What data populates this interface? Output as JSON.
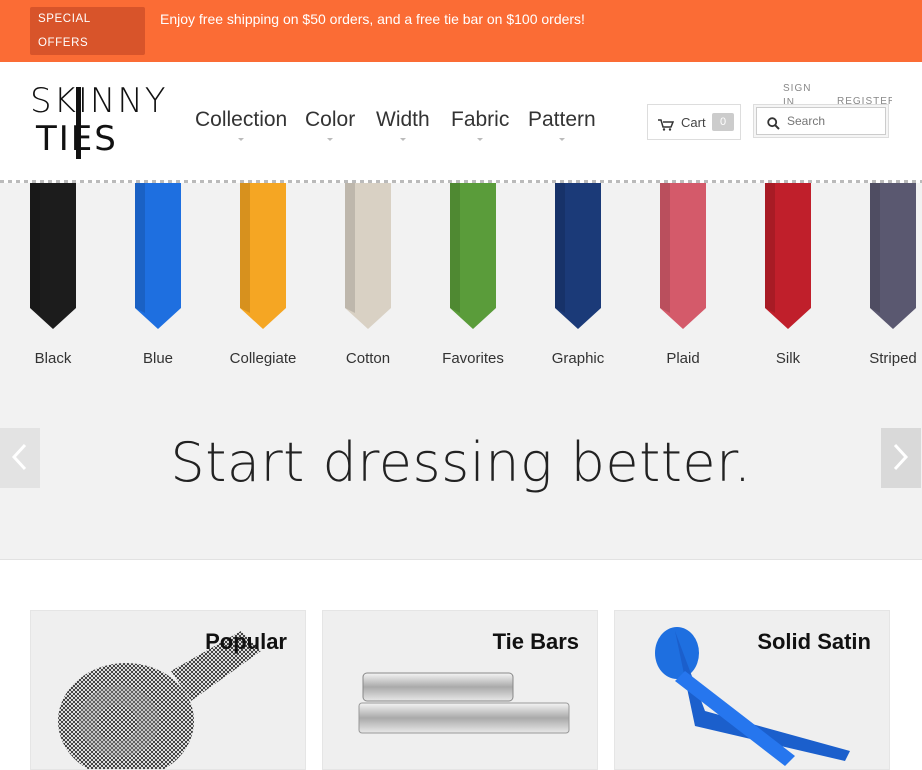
{
  "promo": {
    "badge_line1": "SPECIAL",
    "badge_line2": "OFFERS",
    "message": "Enjoy free shipping on $50 orders, and a free tie bar on $100 orders!",
    "background": "#fb6c35"
  },
  "logo": {
    "line1": "SKINNY",
    "line2": "TIES"
  },
  "nav": [
    "Collection",
    "Color",
    "Width",
    "Fabric",
    "Pattern"
  ],
  "cart": {
    "label": "Cart",
    "count": "0"
  },
  "account": {
    "sign_in": "SIGN IN",
    "register": "REGISTER"
  },
  "search": {
    "placeholder": "Search"
  },
  "ties": [
    {
      "label": "Black",
      "color": "#1c1c1c"
    },
    {
      "label": "Blue",
      "color": "#1e6fe0"
    },
    {
      "label": "Collegiate",
      "color": "#f5a623"
    },
    {
      "label": "Cotton",
      "color": "#d9d1c4"
    },
    {
      "label": "Favorites",
      "color": "#5a9c3a"
    },
    {
      "label": "Graphic",
      "color": "#1b3a78"
    },
    {
      "label": "Plaid",
      "color": "#d45a6a"
    },
    {
      "label": "Silk",
      "color": "#c01f2b"
    },
    {
      "label": "Striped",
      "color": "#5a5870"
    }
  ],
  "hero": {
    "headline": "Start dressing better."
  },
  "cards": [
    {
      "title": "Popular"
    },
    {
      "title": "Tie Bars"
    },
    {
      "title": "Solid Satin"
    }
  ]
}
